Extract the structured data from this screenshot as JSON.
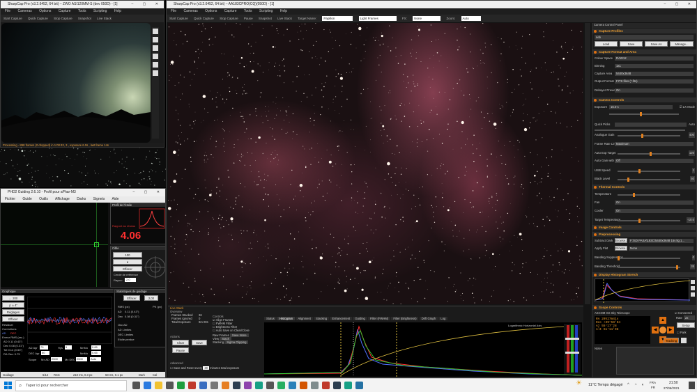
{
  "sharpcap_main": {
    "title": "SharpCap Pro (v3.2.6452, 64 bit) – AA183CPRO(CQ)(050D) - [1]",
    "menu": [
      "File",
      "Cameras",
      "Options",
      "Capture",
      "Tools",
      "Scripting",
      "Help"
    ],
    "toolbar": {
      "start": "Start Capture",
      "quick": "Quick Capture",
      "stop": "Stop Capture",
      "pause": "Pause",
      "snapshot": "Snapshot",
      "live_stack": "Live Stack",
      "target_label": "Target Name:",
      "target_value": "Papillon",
      "frames": "Light Frames",
      "fx_label": "FX:",
      "fx_value": "None",
      "zoom_label": "Zoom:",
      "zoom_value": "Auto"
    }
  },
  "sharpcap_small": {
    "title": "SharpCap Pro (v3.2.6452, 64 bit) – ZWO ASI120MM-S (dev 050D) - [1]",
    "menu": [
      "File",
      "Cameras",
      "Options",
      "Capture",
      "Tools",
      "Scripting",
      "Help"
    ],
    "toolbar": {
      "start": "Start Capture",
      "quick": "Quick Capture",
      "stop": "Stop Capture",
      "snapshot": "Snapshot",
      "live_stack": "Live Stack"
    },
    "status": "Processing - 898 frames (0 dropped) in 1:00:43, 3 , exposure 6.0s , last frame 14s"
  },
  "control_panel": {
    "title": "Camera Control Panel",
    "sections": {
      "profiles": "Capture Profiles",
      "format": "Capture Format and Area",
      "controls": "Camera Controls",
      "thermal": "Thermal Controls",
      "image": "Image Controls",
      "preprocessing": "Preprocessing",
      "histogram": "Display Histogram Stretch",
      "scope": "Scope Controls"
    },
    "profile_value": "neb",
    "profile_buttons": [
      "Load",
      "Save",
      "Save As",
      "Manage..."
    ],
    "format_rows": [
      {
        "label": "Colour Space",
        "value": "RAW12"
      },
      {
        "label": "Binning",
        "value": "1x1"
      },
      {
        "label": "Capture Area",
        "value": "5440x3648"
      },
      {
        "label": "Output Format",
        "value": "FITS files (*.fits)"
      },
      {
        "label": "Debayer Preview",
        "value": "On"
      }
    ],
    "controls_rows": [
      {
        "label": "Exposure",
        "value": "15.0 s"
      },
      {
        "label": "Quick Picks",
        "value": ""
      },
      {
        "label": "Analogue Gain",
        "value": "400"
      },
      {
        "label": "Frame Rate Limit",
        "value": "Maximum"
      },
      {
        "label": "Auto Exp Target",
        "value": "120"
      },
      {
        "label": "Auto Gain with Auto Exposure",
        "value": "Off"
      },
      {
        "label": "USB Speed",
        "value": "1"
      },
      {
        "label": "Black Level",
        "value": "50"
      }
    ],
    "lx_mode": "LX Mode",
    "auto": "Auto",
    "thermal_rows": [
      {
        "label": "Temperature",
        "value": ""
      },
      {
        "label": "Fan",
        "value": "On"
      },
      {
        "label": "Cooler",
        "value": "On"
      },
      {
        "label": "Target Temperature",
        "value": "-10.0"
      }
    ],
    "pre_rows": [
      {
        "label": "Subtract Dark",
        "value": "F:\\SD PASA\\183C\\5440x3648 15s lig 1..."
      },
      {
        "label": "Apply Flat",
        "value": "None"
      },
      {
        "label": "Banding Suppression",
        "value": "0"
      },
      {
        "label": "Banding Threshold",
        "value": "35"
      }
    ],
    "browse": "Browse...",
    "scope": {
      "name": "ASCOM GS Sky Telescope",
      "connected": "Connected",
      "rate_label": "Rate",
      "rate_value": "2x",
      "setup": "Setup",
      "park": "Park",
      "tracking": "Tracking",
      "coords": [
        {
          "label": "RA",
          "value": "20h27m41s"
        },
        {
          "label": "Dec",
          "value": "+39°59'04"
        },
        {
          "label": "Az",
          "value": "55°17'28"
        },
        {
          "label": "Alt",
          "value": "61°11'08"
        }
      ]
    },
    "notes_label": "Notes"
  },
  "live_stack": {
    "title": "Live Stack",
    "overview_label": "Overview",
    "overview": [
      {
        "label": "Frames Stacked",
        "value": "36"
      },
      {
        "label": "Frames Ignored",
        "value": "0"
      },
      {
        "label": "Total Exposure",
        "value": "9m 00s"
      }
    ],
    "actions_label": "Actions",
    "clear": "Clear",
    "save": "Save",
    "pause": "Pause",
    "advanced": "Advanced",
    "save_reset": "Save and Reset every",
    "save_reset_value": "30",
    "save_reset_unit": "minutes total exposure",
    "controls_label": "Controls",
    "checks": [
      "Align Frames",
      "FWHM Filter",
      "Brightness Filter",
      "Auto Save on Clear/Close"
    ],
    "raw_frames": "Raw Frames",
    "raw_frames_value": "Save None",
    "view": "View",
    "view_value": "Stack",
    "stacking": "Stacking",
    "stacking_value": "Sigma Clipping",
    "tabs": [
      "Status",
      "Histogram",
      "Alignment",
      "Stacking",
      "Enhancement",
      "Guiding",
      "Filter (FWHM)",
      "Filter (Brightness)",
      "Drift Graph",
      "Log"
    ],
    "active_tab": "Histogram",
    "legend": "Logarithmic Horizontal Axis"
  },
  "phd": {
    "title": "PHD2 Guiding 2.6.10 - Profil pour aPhar-M3",
    "menu": [
      "Fichier",
      "Guide",
      "Outils",
      "Affichage",
      "Darks",
      "Signets",
      "Aide"
    ],
    "star_profile_title": "Profil de l'étoile",
    "star_hint": "Rapport au réseau",
    "hfd_value": "4.06",
    "hfd_label": "HFD",
    "targets": {
      "title": "Cible"
    },
    "buttons": {
      "guide_100": "100",
      "effacer": "Effacer"
    },
    "circle_label": "Cercle de référence",
    "rayon_label": "Rayon:",
    "rayon_value": "2.0",
    "graph_title": "Graphique",
    "graph_buttons": [
      "← 200",
      "y: ± 4\"",
      "Réglages",
      "Effacer"
    ],
    "legend_labels": [
      "Résiduel",
      "Corrections",
      "AD",
      "DEC"
    ],
    "rms_label": "Erreur RMS (arc.)",
    "rms_rows": [
      "AD 0.11 (0.43\")",
      "Dec 0.08 (0.31\")",
      "Tot 0.14 (0.53\")"
    ],
    "ra_osc": "RA Osc: 0.75",
    "stats_title": "Statistiques de guidage",
    "stats_button": "Effacer",
    "stats_select": "2,00",
    "stats": [
      {
        "label": "RMS (px)",
        "value": "PK (px)"
      },
      {
        "label": "AD",
        "value": "0.11 (0.43\")"
      },
      {
        "label": "Dec",
        "value": "0.08 (0.31\")"
      }
    ],
    "stats2": [
      "Osc AD",
      "AD Limites",
      "DEC Limites",
      "Etoile perdue"
    ],
    "ad_agr_label": "AD Agr",
    "ad_agr_value": "70",
    "hys_label": "Hys",
    "hys_value": "5",
    "mnmo_label": "MnMo",
    "mnmo_value": "0.65",
    "dec_agr_label": "DEC Agr",
    "dec_agr_value": "60",
    "dec_mnmo_value": "0.65",
    "scope_label": "Scope",
    "mx_ad_label": "Mx AD",
    "mx_ad_value": "2500",
    "mx_dec_label": "Mx DEC",
    "mx_dec_value": "2500",
    "dec_mode": "Auto",
    "status_left": "Guidage",
    "status_snr": "5/12",
    "status_rss": "RSS",
    "status_ms": "210 ms, 0.3 px",
    "status_ms2": "58 ms, 0.1 px",
    "status_dark": "Dark",
    "status_cal": "Cal"
  },
  "taskbar": {
    "search_placeholder": "Taper ici pour rechercher",
    "weather": "11°C  Temps dégagé",
    "lang": "FRA",
    "lang2": "FR",
    "time": "21:50",
    "date": "27/06/2021"
  }
}
